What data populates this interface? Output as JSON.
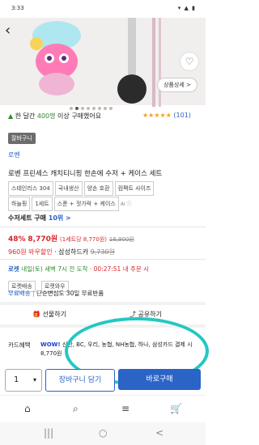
{
  "status": {
    "time": "3:33",
    "icons": "▾ ▲ ▮"
  },
  "gallery": {
    "detail_label": "상품상세 >",
    "heart": "♡",
    "back": "‹"
  },
  "promo": {
    "text_prefix": "한 달간 ",
    "count": "400명",
    "text_suffix": " 이상 구매했어요",
    "rating_count": "(101)",
    "stars": "★★★★★"
  },
  "brand": {
    "chip": "잘바구니",
    "name": "로벤"
  },
  "title": {
    "line1": "로벤 프린세스 캐치티니핑 한손에 수저 + 케이스 세트"
  },
  "tags": [
    "스테인리스 304",
    "국내생산",
    "양손 호환",
    "컴팩트 사이즈",
    "하늘핑",
    "1세트",
    "스푼 + 젓가락 + 케이스"
  ],
  "tags_tail": "AI ⓘ",
  "set_label": "수저세트 구매",
  "set_count": "10위 >",
  "price": {
    "discount": "48%",
    "amount": "8,770원",
    "unit": "(1세트당 8,770원)",
    "original": "16,900원"
  },
  "coupon": {
    "label": "960원 와우할인",
    "extra": "· 삼성하드카",
    "strike": "9,730원"
  },
  "delivery": {
    "badge": "로켓",
    "text": "내일(토) 새벽 7시 전 도착",
    "countdown": "· 00:27:51 내 주문 시"
  },
  "ship_chips": [
    "로켓배송",
    "로켓와우"
  ],
  "return_line": {
    "free": "무료배송",
    "policy": "단순변심도 30일 무료반품"
  },
  "actions": {
    "gift": "선물하기",
    "share": "공유하기"
  },
  "card": {
    "label": "카드혜택",
    "wow": "WOW!",
    "list": "신한, BC, 우리, 농협, NH농협, 하나, 삼성카드 결제 시 8,770원"
  },
  "bottom": {
    "qty": "1",
    "cart": "장바구니 담기",
    "buy": "바로구매"
  },
  "nav": {
    "home": "⌂",
    "search": "⌕",
    "menu": "≡",
    "cart": "🛒"
  },
  "system": {
    "recent": "|||",
    "home": "○",
    "back": "<"
  }
}
